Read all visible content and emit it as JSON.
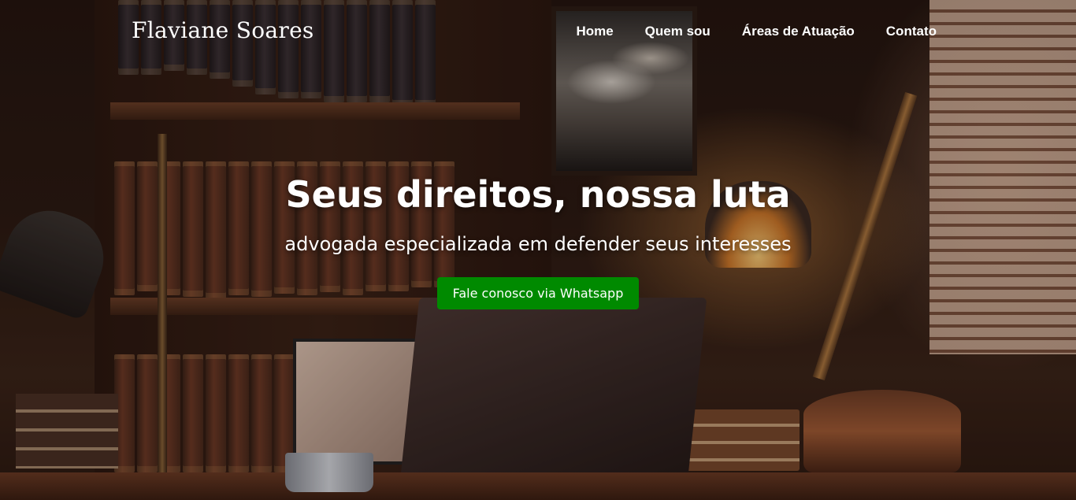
{
  "header": {
    "brand": "Flaviane Soares",
    "nav": [
      {
        "label": "Home"
      },
      {
        "label": "Quem sou"
      },
      {
        "label": "Áreas de Atuação"
      },
      {
        "label": "Contato"
      }
    ]
  },
  "hero": {
    "title": "Seus direitos, nossa luta",
    "subtitle": "advogada especializada em defender seus interesses",
    "cta_label": "Fale conosco via Whatsapp",
    "cta_color": "#008a00",
    "background": "law-office-library-scene"
  }
}
